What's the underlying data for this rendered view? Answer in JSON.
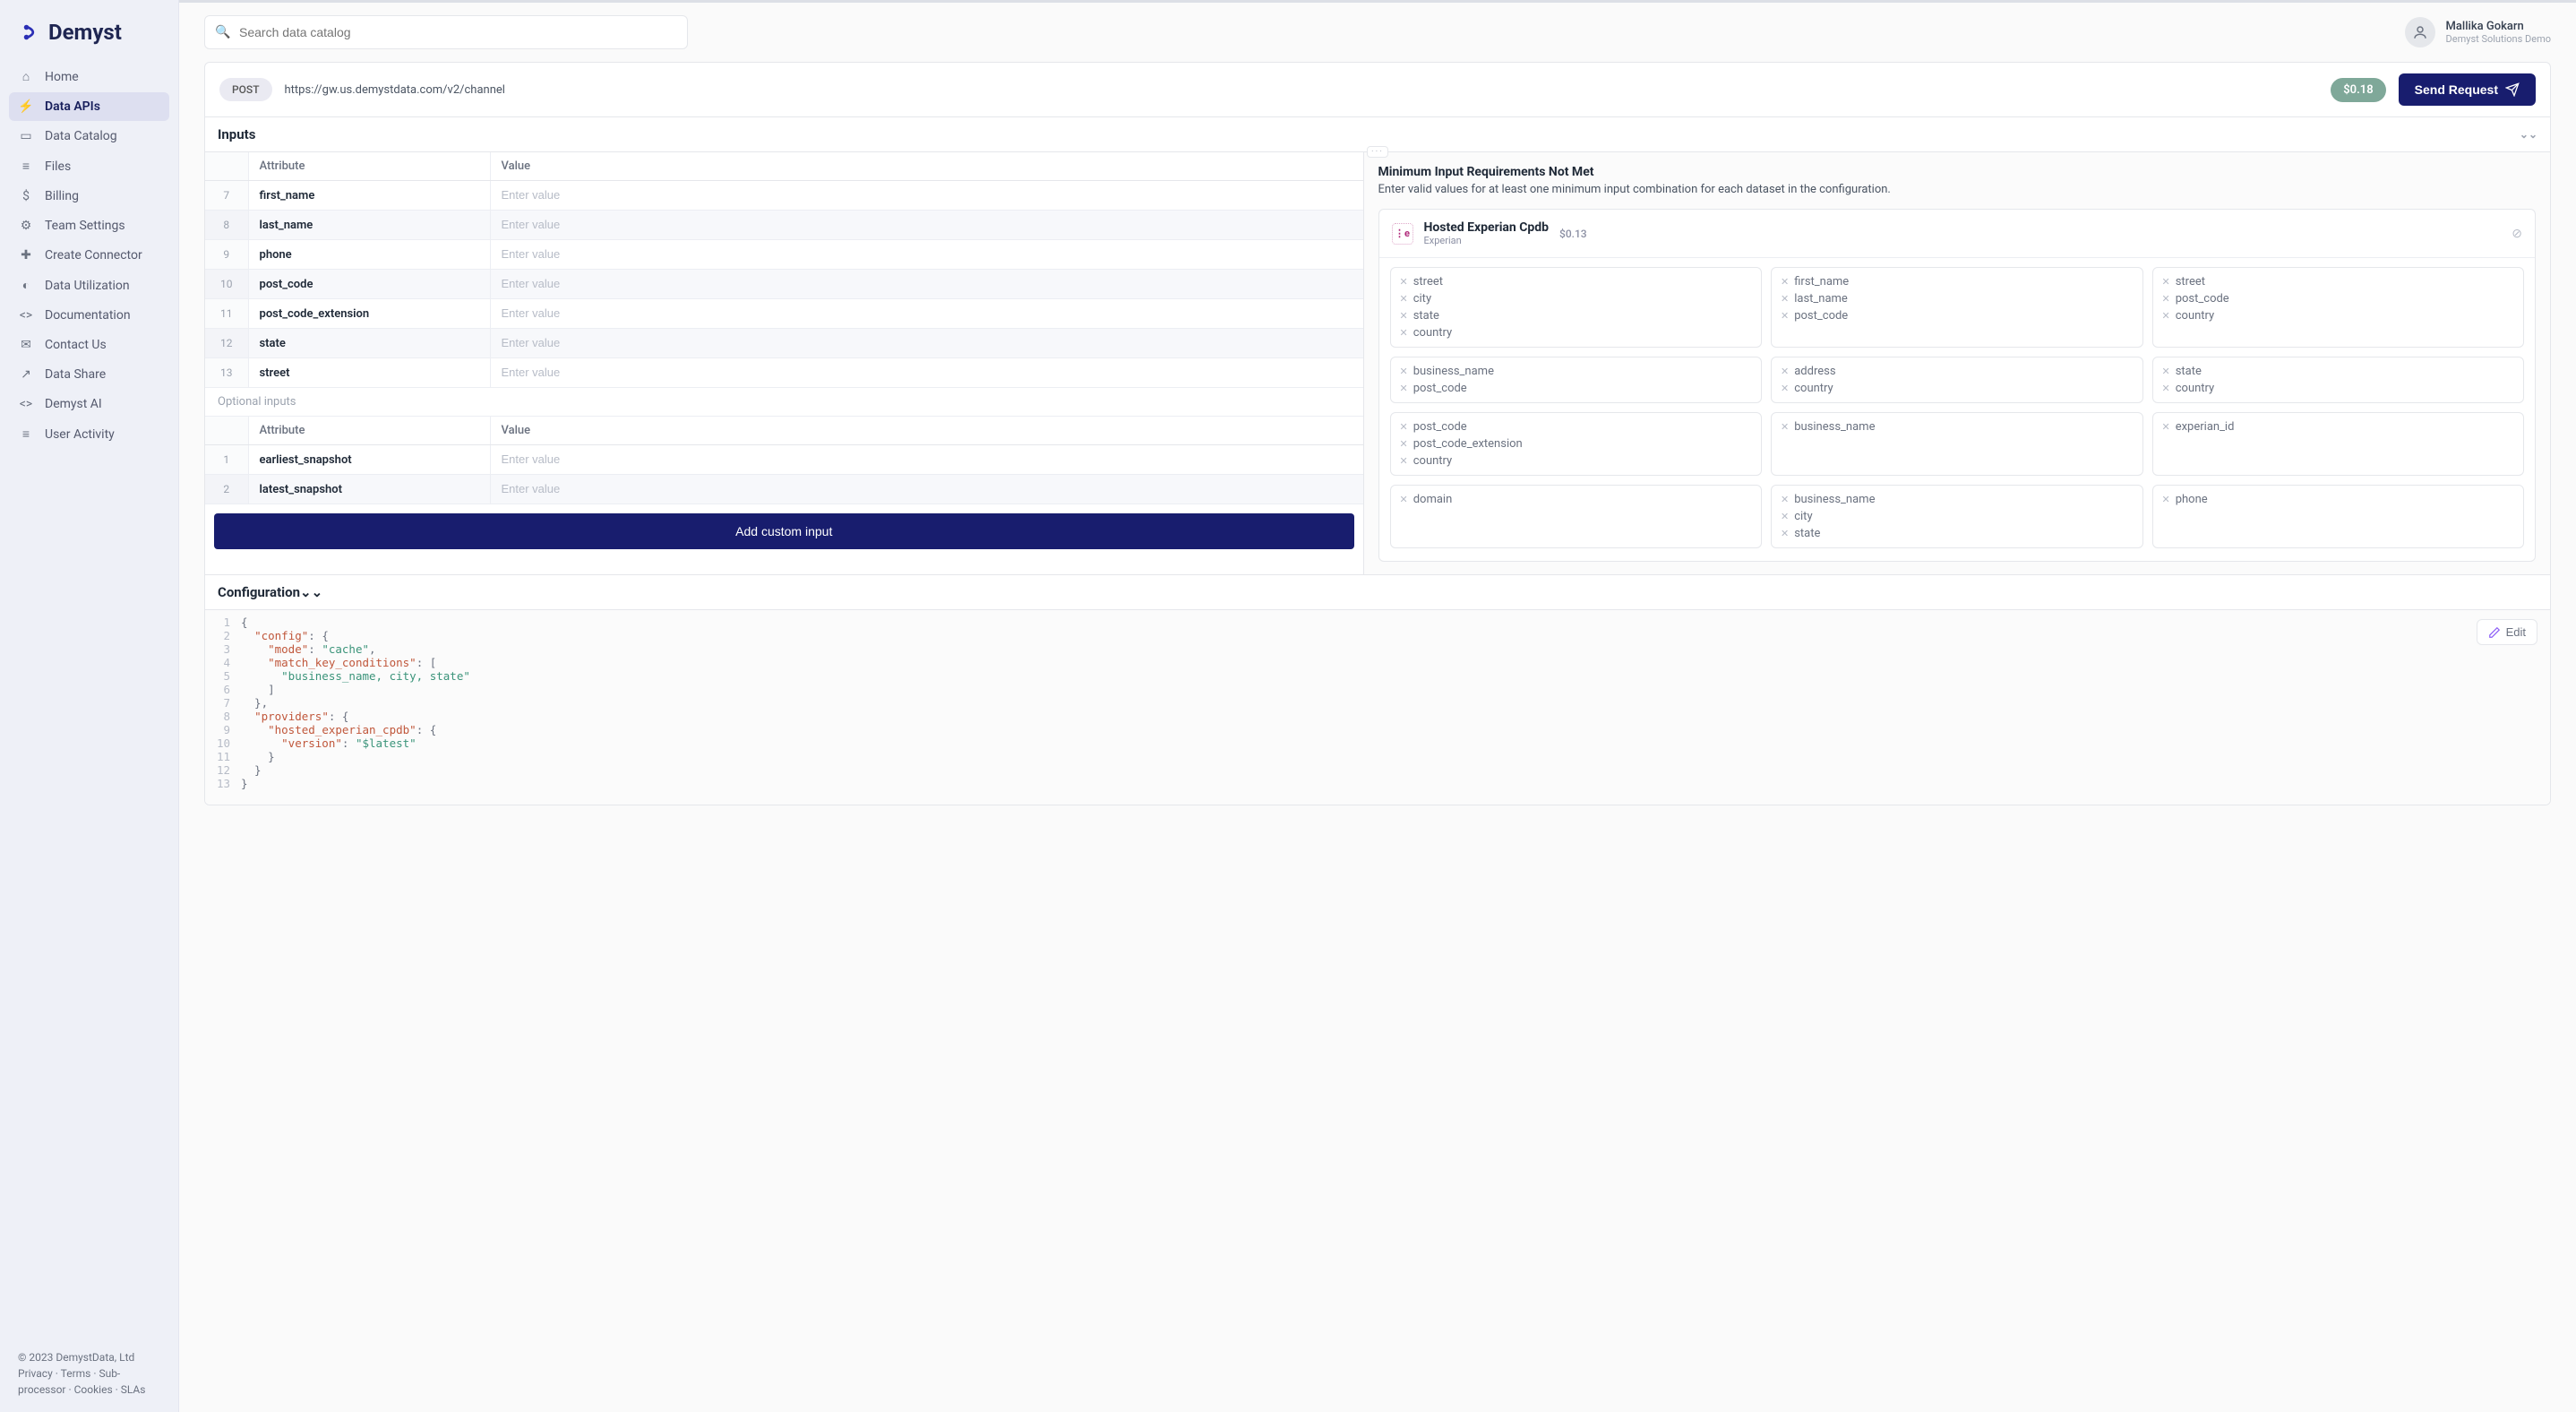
{
  "brand": "Demyst",
  "search": {
    "placeholder": "Search data catalog"
  },
  "user": {
    "name": "Mallika Gokarn",
    "org": "Demyst Solutions Demo"
  },
  "nav": [
    {
      "label": "Home",
      "icon": "⌂",
      "active": false
    },
    {
      "label": "Data APIs",
      "icon": "⚡",
      "active": true
    },
    {
      "label": "Data Catalog",
      "icon": "▭",
      "active": false
    },
    {
      "label": "Files",
      "icon": "≡",
      "active": false
    },
    {
      "label": "Billing",
      "icon": "$",
      "active": false
    },
    {
      "label": "Team Settings",
      "icon": "⚙",
      "active": false
    },
    {
      "label": "Create Connector",
      "icon": "✚",
      "active": false
    },
    {
      "label": "Data Utilization",
      "icon": "◐",
      "active": false
    },
    {
      "label": "Documentation",
      "icon": "<>",
      "active": false
    },
    {
      "label": "Contact Us",
      "icon": "✉",
      "active": false
    },
    {
      "label": "Data Share",
      "icon": "↗",
      "active": false
    },
    {
      "label": "Demyst AI",
      "icon": "<>",
      "active": false
    },
    {
      "label": "User Activity",
      "icon": "≡",
      "active": false
    }
  ],
  "footer": {
    "copyright": "© 2023 DemystData, Ltd",
    "links": [
      "Privacy",
      "Terms",
      "Sub-processor",
      "Cookies",
      "SLAs"
    ]
  },
  "request": {
    "method": "POST",
    "url": "https://gw.us.demystdata.com/v2/channel",
    "price": "$0.18",
    "send": "Send Request"
  },
  "inputs": {
    "title": "Inputs",
    "cols": {
      "attr": "Attribute",
      "val": "Value"
    },
    "placeholder": "Enter value",
    "rows": [
      {
        "n": "7",
        "attr": "first_name"
      },
      {
        "n": "8",
        "attr": "last_name"
      },
      {
        "n": "9",
        "attr": "phone"
      },
      {
        "n": "10",
        "attr": "post_code"
      },
      {
        "n": "11",
        "attr": "post_code_extension"
      },
      {
        "n": "12",
        "attr": "state"
      },
      {
        "n": "13",
        "attr": "street"
      }
    ],
    "optional_label": "Optional inputs",
    "optional_rows": [
      {
        "n": "1",
        "attr": "earliest_snapshot"
      },
      {
        "n": "2",
        "attr": "latest_snapshot"
      }
    ],
    "add": "Add custom input"
  },
  "requirements": {
    "title": "Minimum Input Requirements Not Met",
    "sub": "Enter valid values for at least one minimum input combination for each dataset in the configuration.",
    "provider": {
      "name": "Hosted Experian Cpdb",
      "vendor": "Experian",
      "price": "$0.13"
    },
    "groups": [
      [
        [
          "street",
          "city",
          "state",
          "country"
        ],
        [
          "first_name",
          "last_name",
          "post_code"
        ],
        [
          "street",
          "post_code",
          "country"
        ]
      ],
      [
        [
          "business_name",
          "post_code"
        ],
        [
          "address",
          "country"
        ],
        [
          "state",
          "country"
        ]
      ],
      [
        [
          "post_code",
          "post_code_extension",
          "country"
        ],
        [
          "business_name"
        ],
        [
          "experian_id"
        ]
      ],
      [
        [
          "domain"
        ],
        [
          "business_name",
          "city",
          "state"
        ],
        [
          "phone"
        ]
      ]
    ]
  },
  "config": {
    "title": "Configuration",
    "edit": "Edit",
    "lines": [
      {
        "n": 1,
        "seg": [
          {
            "t": "{",
            "c": "pu"
          }
        ]
      },
      {
        "n": 2,
        "seg": [
          {
            "t": "  ",
            "c": ""
          },
          {
            "t": "\"config\"",
            "c": "ky"
          },
          {
            "t": ": {",
            "c": "pu"
          }
        ]
      },
      {
        "n": 3,
        "seg": [
          {
            "t": "    ",
            "c": ""
          },
          {
            "t": "\"mode\"",
            "c": "ky"
          },
          {
            "t": ": ",
            "c": "pu"
          },
          {
            "t": "\"cache\"",
            "c": "st"
          },
          {
            "t": ",",
            "c": "pu"
          }
        ]
      },
      {
        "n": 4,
        "seg": [
          {
            "t": "    ",
            "c": ""
          },
          {
            "t": "\"match_key_conditions\"",
            "c": "ky"
          },
          {
            "t": ": [",
            "c": "pu"
          }
        ]
      },
      {
        "n": 5,
        "seg": [
          {
            "t": "      ",
            "c": ""
          },
          {
            "t": "\"business_name, city, state\"",
            "c": "st"
          }
        ]
      },
      {
        "n": 6,
        "seg": [
          {
            "t": "    ]",
            "c": "pu"
          }
        ]
      },
      {
        "n": 7,
        "seg": [
          {
            "t": "  },",
            "c": "pu"
          }
        ]
      },
      {
        "n": 8,
        "seg": [
          {
            "t": "  ",
            "c": ""
          },
          {
            "t": "\"providers\"",
            "c": "ky"
          },
          {
            "t": ": {",
            "c": "pu"
          }
        ]
      },
      {
        "n": 9,
        "seg": [
          {
            "t": "    ",
            "c": ""
          },
          {
            "t": "\"hosted_experian_cpdb\"",
            "c": "ky"
          },
          {
            "t": ": {",
            "c": "pu"
          }
        ]
      },
      {
        "n": 10,
        "seg": [
          {
            "t": "      ",
            "c": ""
          },
          {
            "t": "\"version\"",
            "c": "ky"
          },
          {
            "t": ": ",
            "c": "pu"
          },
          {
            "t": "\"$latest\"",
            "c": "st"
          }
        ]
      },
      {
        "n": 11,
        "seg": [
          {
            "t": "    }",
            "c": "pu"
          }
        ]
      },
      {
        "n": 12,
        "seg": [
          {
            "t": "  }",
            "c": "pu"
          }
        ]
      },
      {
        "n": 13,
        "seg": [
          {
            "t": "}",
            "c": "pu"
          }
        ]
      }
    ]
  }
}
